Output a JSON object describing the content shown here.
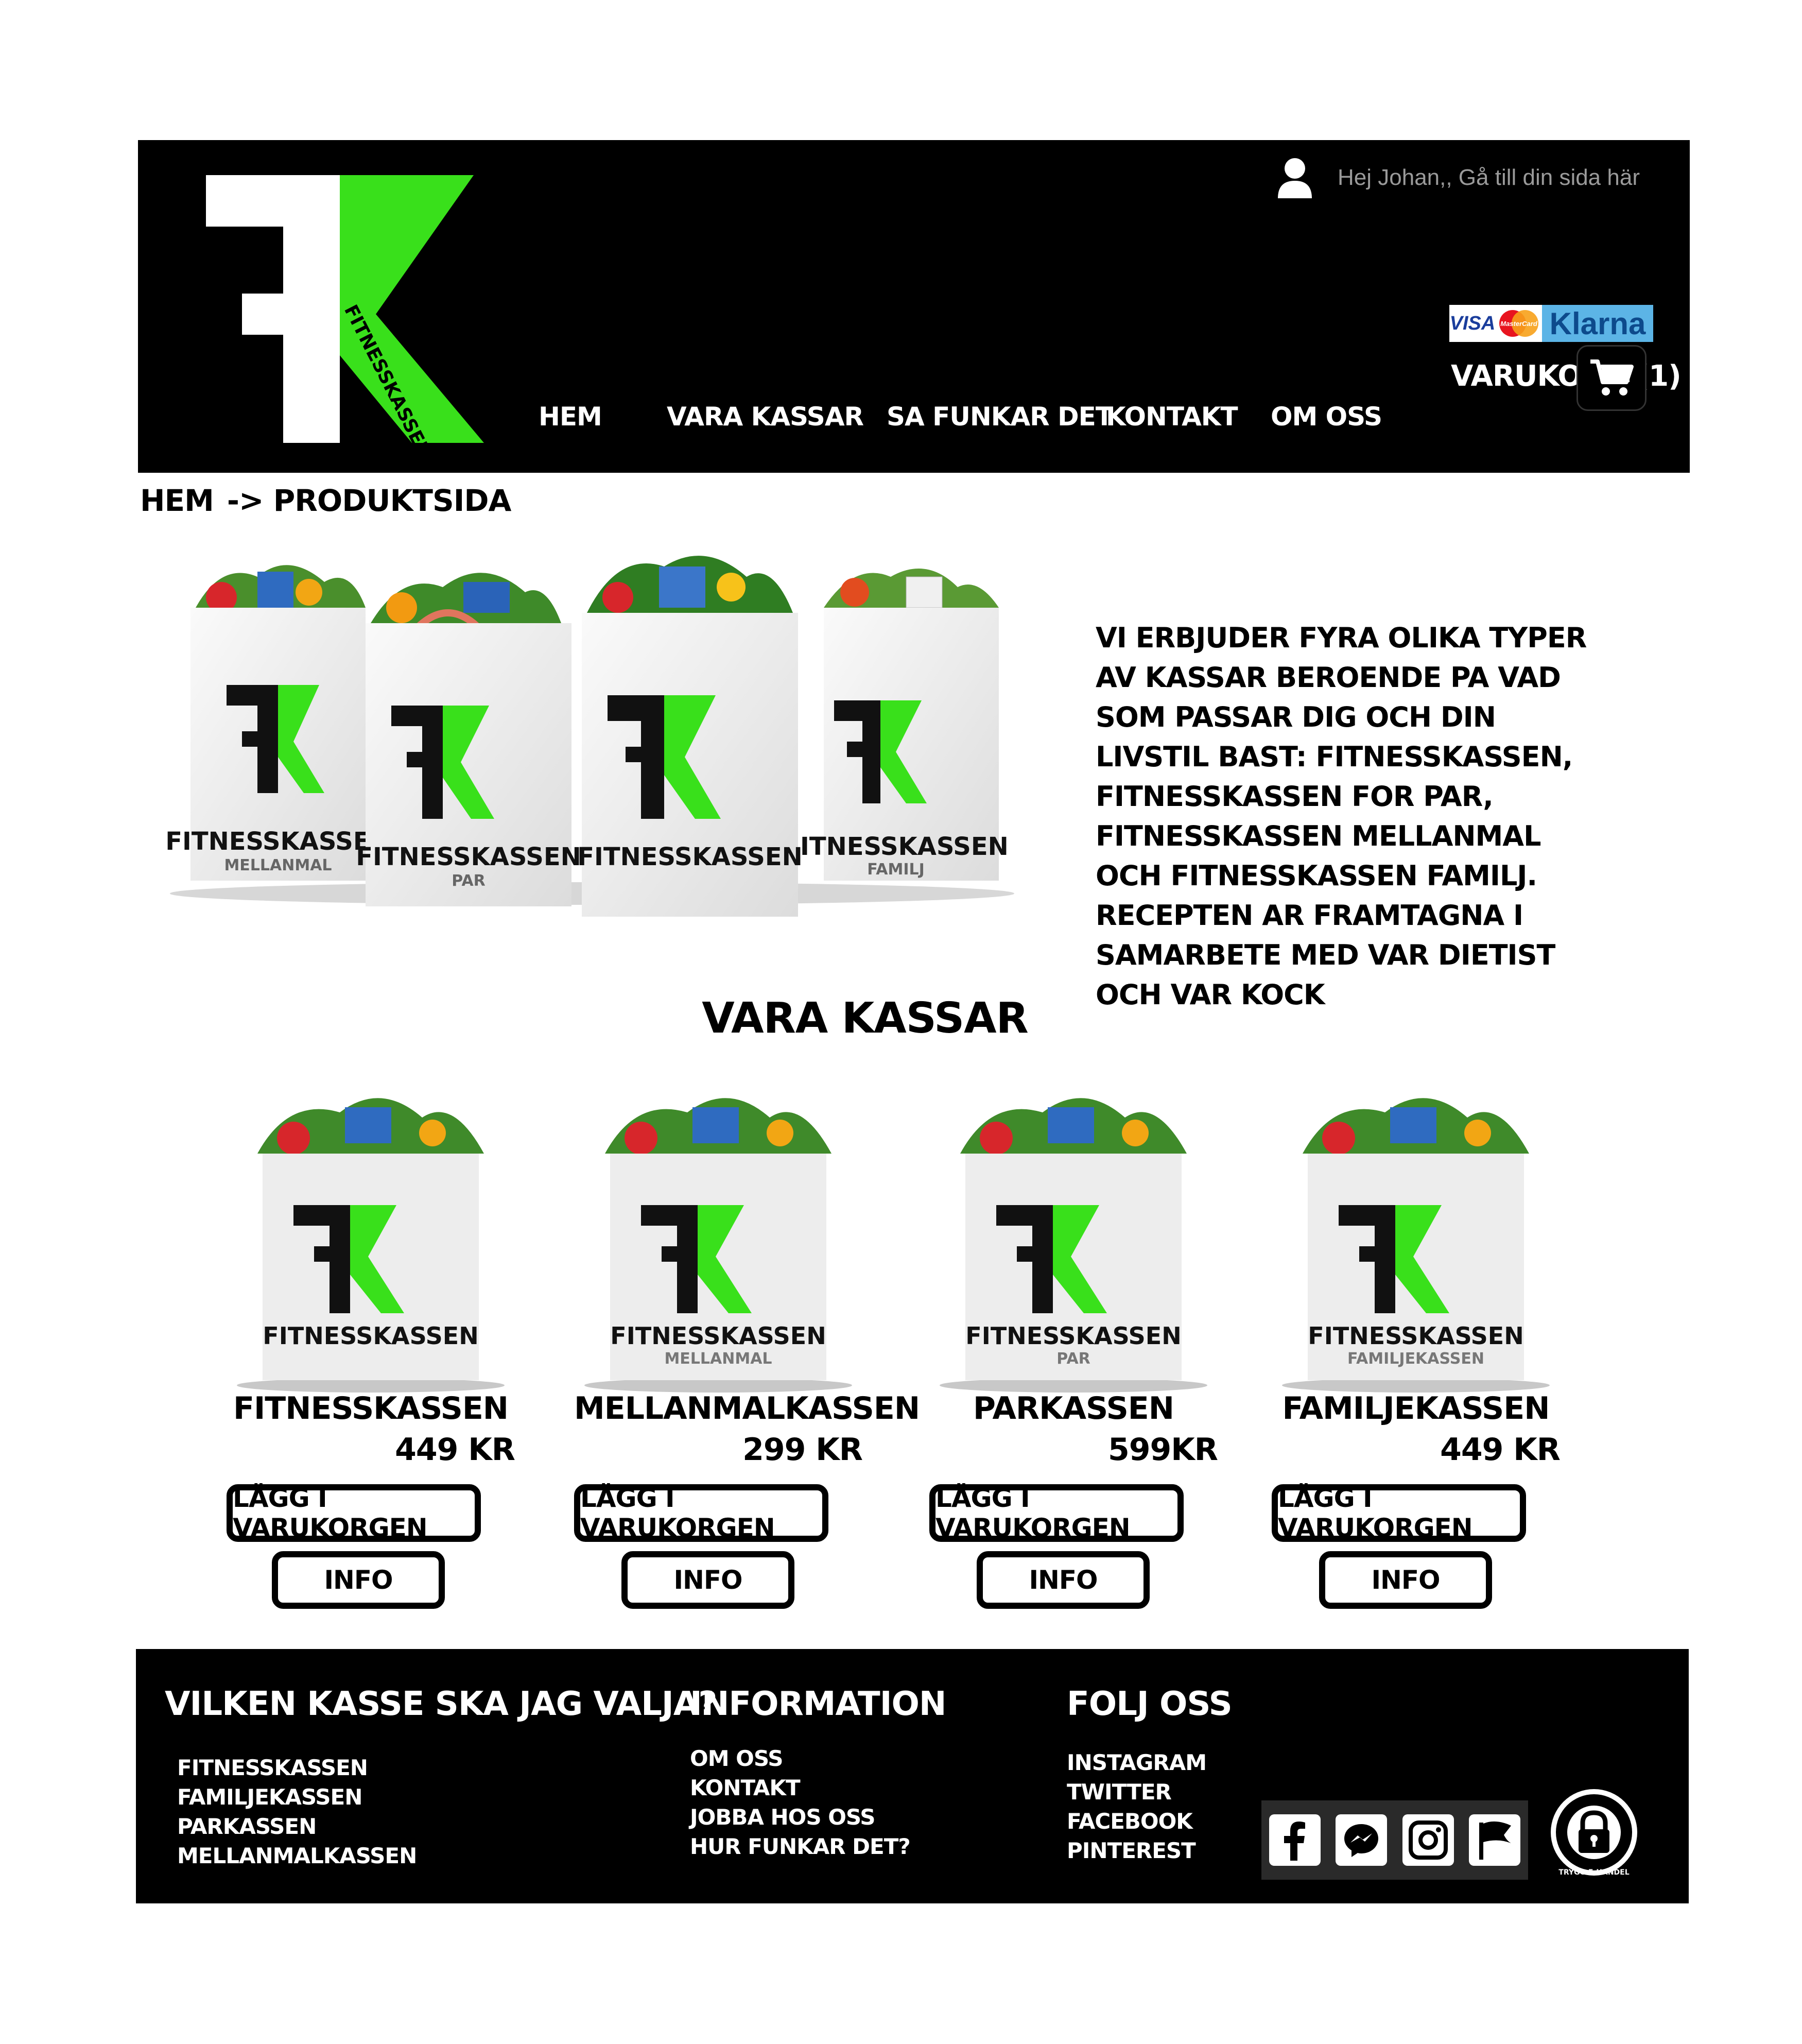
{
  "header": {
    "user_greeting": "Hej Johan,, Gå till din sida här",
    "cart_label": "VARUKORG (1)",
    "logo_text": "FITNESSKASSEN",
    "payment": {
      "visa": "VISA",
      "mastercard": "MasterCard",
      "klarna": "Klarna"
    },
    "nav": [
      "HEM",
      "VARA KASSAR",
      "SA FUNKAR DET",
      "KONTAKT",
      "OM OSS"
    ]
  },
  "breadcrumb": {
    "home": "HEM",
    "current": "-> PRODUKTSIDA"
  },
  "hero": {
    "description": "VI ERBJUDER FYRA OLIKA TYPER AV KASSAR BEROENDE PA VAD SOM PASSAR DIG OCH DIN LIVSTIL BAST: FITNESSKASSEN, FITNESSKASSEN FOR PAR, FITNESSKASSEN MELLANMAL OCH FITNESSKASSEN FAMILJ. RECEPTEN AR FRAMTAGNA I SAMARBETE MED VAR DIETIST OCH VAR  KOCK",
    "bags": [
      {
        "brand": "FITNESSKASSEN",
        "sub": "MELLANMAL"
      },
      {
        "brand": "FITNESSKASSEN",
        "sub": "PAR"
      },
      {
        "brand": "FITNESSKASSEN",
        "sub": ""
      },
      {
        "brand": "FITNESSKASSEN",
        "sub": "FAMILJ"
      }
    ]
  },
  "section_title": "VARA KASSAR",
  "products": [
    {
      "name": "FITNESSKASSEN",
      "price": "449 KR",
      "bag_brand": "FITNESSKASSEN",
      "bag_sub": "",
      "add_label": "LÄGG I VARUKORGEN",
      "info_label": "INFO"
    },
    {
      "name": "MELLANMALKASSEN",
      "price": "299 KR",
      "bag_brand": "FITNESSKASSEN",
      "bag_sub": "MELLANMAL",
      "add_label": "LÄGG I VARUKORGEN",
      "info_label": "INFO"
    },
    {
      "name": "PARKASSEN",
      "price": "599KR",
      "bag_brand": "FITNESSKASSEN",
      "bag_sub": "PAR",
      "add_label": "LÄGG I VARUKORGEN",
      "info_label": "INFO"
    },
    {
      "name": "FAMILJEKASSEN",
      "price": "449 KR",
      "bag_brand": "FITNESSKASSEN",
      "bag_sub": "FAMILJEKASSEN",
      "add_label": "LÄGG I VARUKORGEN",
      "info_label": "INFO"
    }
  ],
  "footer": {
    "col1": {
      "title": "VILKEN KASSE SKA JAG VALJA?",
      "links": [
        "FITNESSKASSEN",
        "FAMILJEKASSEN",
        "PARKASSEN",
        "MELLANMALKASSEN"
      ]
    },
    "col2": {
      "title": "INFORMATION",
      "links": [
        "OM OSS",
        "KONTAKT",
        "JOBBA HOS OSS",
        "HUR FUNKAR DET?"
      ]
    },
    "col3": {
      "title": "FOLJ OSS",
      "links": [
        "INSTAGRAM",
        "TWITTER",
        "FACEBOOK",
        "PINTEREST"
      ]
    },
    "badge_text": "TRYGG E-HANDEL",
    "social_icons": [
      "facebook-icon",
      "messenger-icon",
      "instagram-icon",
      "flag-icon"
    ]
  },
  "colors": {
    "brand_green": "#39e01b",
    "black": "#000000",
    "klarna_blue": "#5cb4e6"
  }
}
